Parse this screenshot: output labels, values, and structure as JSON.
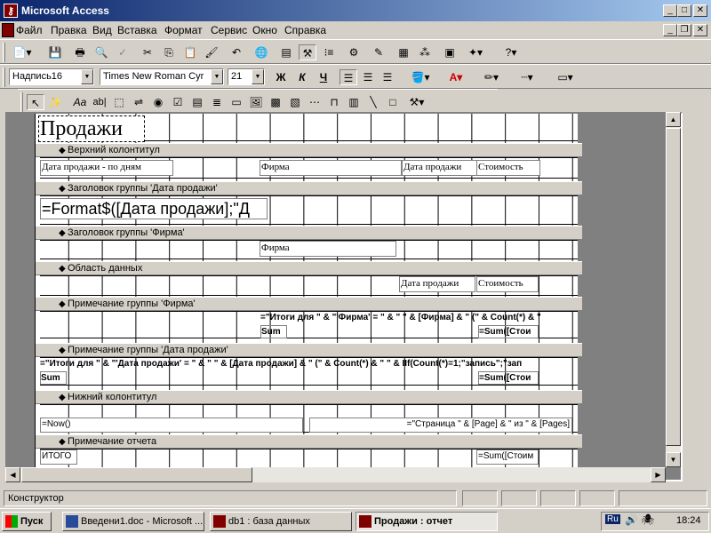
{
  "window": {
    "title": "Microsoft Access",
    "icon": "access-key-icon"
  },
  "menu": [
    "Файл",
    "Правка",
    "Вид",
    "Вставка",
    "Формат",
    "Сервис",
    "Окно",
    "Справка"
  ],
  "format_toolbar": {
    "object_combo": "Надпись16",
    "font_combo": "Times New Roman Cyr",
    "size_combo": "21",
    "bold": "Ж",
    "italic": "К",
    "underline": "Ч"
  },
  "toolbox": {
    "label_tool": "Aa",
    "textbox_tool": "ab|"
  },
  "report": {
    "title_label": "Продажи",
    "sections": [
      {
        "label": "Верхний колонтитул"
      },
      {
        "label": "Заголовок группы 'Дата продажи'"
      },
      {
        "label": "Заголовок группы 'Фирма'"
      },
      {
        "label": "Область данных"
      },
      {
        "label": "Примечание группы 'Фирма'"
      },
      {
        "label": "Примечание группы 'Дата продажи'"
      },
      {
        "label": "Нижний колонтитул"
      },
      {
        "label": "Примечание отчета"
      }
    ],
    "page_header": {
      "date_label": "Дата продажи - по дням",
      "firm_label": "Фирма",
      "sale_date_label": "Дата продажи",
      "cost_label": "Стоимость"
    },
    "date_group_header": {
      "expr": "=Format$([Дата продажи];\"Д"
    },
    "firm_group_header": {
      "firm_field": "Фирма"
    },
    "detail": {
      "sale_date_field": "Дата продажи",
      "cost_field": "Стоимость"
    },
    "firm_footer": {
      "totals_expr": "=\"Итоги для \" & \"'Фирма' = \" & \" \" & [Фирма] & \" (\" & Count(*) & \"",
      "sum_label": "Sum",
      "sum_field": "=Sum([Стои"
    },
    "date_footer": {
      "totals_expr": "=\"Итоги для \" & \"'Дата продажи' = \" & \" \" & [Дата продажи] & \" (\" & Count(*) & \" \" & IIf(Count(*)=1;\"запись\";\"зап",
      "sum_label": "Sum",
      "sum_field": "=Sum([Стои"
    },
    "page_footer": {
      "now_field": "=Now()",
      "page_field": "=\"Страница \" & [Page] & \" из \" & [Pages]"
    },
    "report_footer": {
      "total_label": "ИТОГО",
      "total_field": "=Sum([Стоим"
    }
  },
  "status": {
    "text": "Конструктор"
  },
  "taskbar": {
    "start": "Пуск",
    "tasks": [
      "Введени1.doc - Microsoft ...",
      "db1 : база данных",
      "Продажи : отчет"
    ],
    "lang": "Ru",
    "clock": "18:24"
  }
}
